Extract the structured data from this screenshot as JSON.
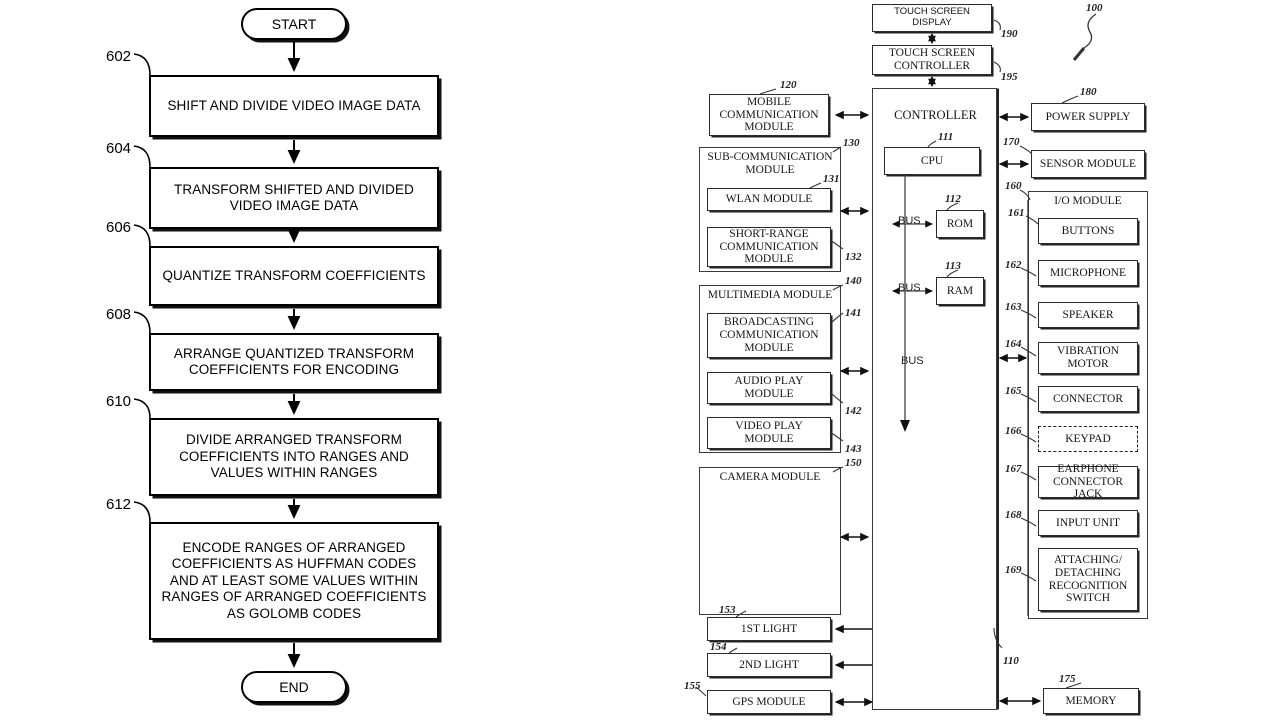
{
  "figure_left": {
    "name": "video-encoding-flowchart",
    "start_label": "START",
    "end_label": "END",
    "steps": [
      {
        "ref": "602",
        "text": "SHIFT AND DIVIDE VIDEO IMAGE DATA"
      },
      {
        "ref": "604",
        "text": "TRANSFORM SHIFTED AND DIVIDED VIDEO IMAGE DATA"
      },
      {
        "ref": "606",
        "text": "QUANTIZE TRANSFORM COEFFICIENTS"
      },
      {
        "ref": "608",
        "text": "ARRANGE QUANTIZED TRANSFORM COEFFICIENTS FOR ENCODING"
      },
      {
        "ref": "610",
        "text": "DIVIDE ARRANGED TRANSFORM COEFFICIENTS INTO RANGES AND VALUES WITHIN RANGES"
      },
      {
        "ref": "612",
        "text": "ENCODE RANGES OF ARRANGED COEFFICIENTS AS HUFFMAN CODES AND AT LEAST SOME VALUES WITHIN RANGES OF ARRANGED COEFFICIENTS AS GOLOMB CODES"
      }
    ]
  },
  "figure_right": {
    "name": "mobile-device-block-diagram",
    "device_ref": "100",
    "touch_screen_display": {
      "label": "TOUCH SCREEN DISPLAY",
      "ref": "190"
    },
    "touch_screen_controller": {
      "label": "TOUCH SCREEN CONTROLLER",
      "ref": "195"
    },
    "controller": {
      "label": "CONTROLLER",
      "ref": "110"
    },
    "cpu": {
      "label": "CPU",
      "ref": "111"
    },
    "rom": {
      "label": "ROM",
      "ref": "112"
    },
    "ram": {
      "label": "RAM",
      "ref": "113"
    },
    "bus_labels": [
      "BUS",
      "BUS",
      "BUS"
    ],
    "mobile_communication_module": {
      "label": "MOBILE COMMUNICATION MODULE",
      "ref": "120"
    },
    "sub_communication_module": {
      "label": "SUB-COMMUNICATION MODULE",
      "ref": "130",
      "children": [
        {
          "label": "WLAN MODULE",
          "ref": "131"
        },
        {
          "label": "SHORT-RANGE COMMUNICATION MODULE",
          "ref": "132"
        }
      ]
    },
    "multimedia_module": {
      "label": "MULTIMEDIA MODULE",
      "ref": "140",
      "children": [
        {
          "label": "BROADCASTING COMMUNICATION MODULE",
          "ref": "141"
        },
        {
          "label": "AUDIO PLAY MODULE",
          "ref": "142"
        },
        {
          "label": "VIDEO PLAY MODULE",
          "ref": "143"
        }
      ]
    },
    "camera_module": {
      "label": "CAMERA MODULE",
      "ref": "150"
    },
    "first_light": {
      "label": "1ST LIGHT",
      "ref": "153"
    },
    "second_light": {
      "label": "2ND LIGHT",
      "ref": "154"
    },
    "gps_module": {
      "label": "GPS MODULE",
      "ref": "155"
    },
    "power_supply": {
      "label": "POWER SUPPLY",
      "ref": "180"
    },
    "sensor_module": {
      "label": "SENSOR MODULE",
      "ref": "170"
    },
    "memory": {
      "label": "MEMORY",
      "ref": "175"
    },
    "io_module": {
      "label": "I/O MODULE",
      "ref": "160",
      "children": [
        {
          "label": "BUTTONS",
          "ref": "161",
          "dashed": false
        },
        {
          "label": "MICROPHONE",
          "ref": "162",
          "dashed": false
        },
        {
          "label": "SPEAKER",
          "ref": "163",
          "dashed": false
        },
        {
          "label": "VIBRATION MOTOR",
          "ref": "164",
          "dashed": false
        },
        {
          "label": "CONNECTOR",
          "ref": "165",
          "dashed": false
        },
        {
          "label": "KEYPAD",
          "ref": "166",
          "dashed": true
        },
        {
          "label": "EARPHONE CONNECTOR JACK",
          "ref": "167",
          "dashed": false
        },
        {
          "label": "INPUT UNIT",
          "ref": "168",
          "dashed": false
        },
        {
          "label": "ATTACHING/ DETACHING RECOGNITION SWITCH",
          "ref": "169",
          "dashed": false
        }
      ]
    }
  },
  "colors": {
    "ink": "#000000",
    "diagram_ink": "#141414",
    "paper": "#ffffff"
  }
}
